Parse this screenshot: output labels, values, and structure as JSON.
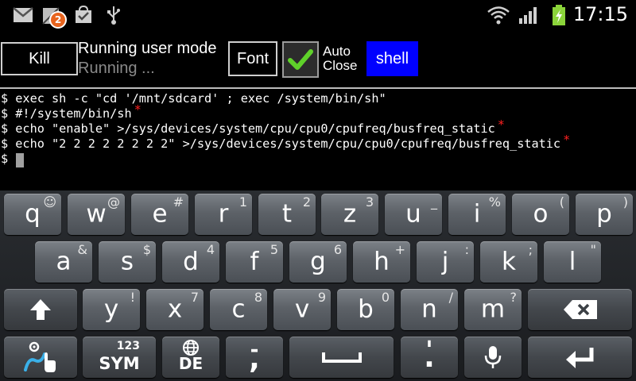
{
  "status_bar": {
    "notification_count": "2",
    "time": "17:15",
    "icons": [
      "gmail-icon",
      "missed-call-icon",
      "market-update-icon",
      "usb-icon",
      "wifi-icon",
      "signal-icon",
      "battery-charging-icon"
    ]
  },
  "toolbar": {
    "kill_label": "Kill",
    "mode_title": "Running user mode",
    "mode_status": "Running ...",
    "font_label": "Font",
    "auto_close_checked": true,
    "auto_close_line1": "Auto",
    "auto_close_line2": "Close",
    "shell_label": "shell",
    "shell_color": "#0000ff"
  },
  "terminal": {
    "lines": [
      {
        "text": "$ exec sh -c \"cd '/mnt/sdcard' ; exec /system/bin/sh\"",
        "star": ""
      },
      {
        "text": "$ #!/system/bin/sh",
        "star": "*"
      },
      {
        "text": "$ echo \"enable\" >/sys/devices/system/cpu/cpu0/cpufreq/busfreq_static",
        "star": "*"
      },
      {
        "text": "$ echo \"2 2 2 2 2 2 2 2\" >/sys/devices/system/cpu/cpu0/cpufreq/busfreq_static",
        "star": "*"
      },
      {
        "text": "$ ",
        "star": ""
      }
    ]
  },
  "keyboard": {
    "row1": [
      {
        "main": "q",
        "alt": "☺"
      },
      {
        "main": "w",
        "alt": "@"
      },
      {
        "main": "e",
        "alt": "#"
      },
      {
        "main": "r",
        "alt": "1"
      },
      {
        "main": "t",
        "alt": "2"
      },
      {
        "main": "z",
        "alt": "3"
      },
      {
        "main": "u",
        "alt": "_"
      },
      {
        "main": "i",
        "alt": "%"
      },
      {
        "main": "o",
        "alt": "("
      },
      {
        "main": "p",
        "alt": ")"
      }
    ],
    "row2": [
      {
        "main": "a",
        "alt": "&"
      },
      {
        "main": "s",
        "alt": "$"
      },
      {
        "main": "d",
        "alt": "4"
      },
      {
        "main": "f",
        "alt": "5"
      },
      {
        "main": "g",
        "alt": "6"
      },
      {
        "main": "h",
        "alt": "+"
      },
      {
        "main": "j",
        "alt": ":"
      },
      {
        "main": "k",
        "alt": ";"
      },
      {
        "main": "l",
        "alt": "\""
      }
    ],
    "row3": [
      {
        "main": "y",
        "alt": "!"
      },
      {
        "main": "x",
        "alt": "7"
      },
      {
        "main": "c",
        "alt": "8"
      },
      {
        "main": "v",
        "alt": "9"
      },
      {
        "main": "b",
        "alt": "0"
      },
      {
        "main": "n",
        "alt": "/"
      },
      {
        "main": "m",
        "alt": "?"
      }
    ],
    "sym_label": "SYM",
    "sym_sup": "123",
    "lang_label": "DE",
    "comma_main": ",",
    "comma_alt": "-",
    "period_main": ".",
    "period_alt": "'"
  }
}
